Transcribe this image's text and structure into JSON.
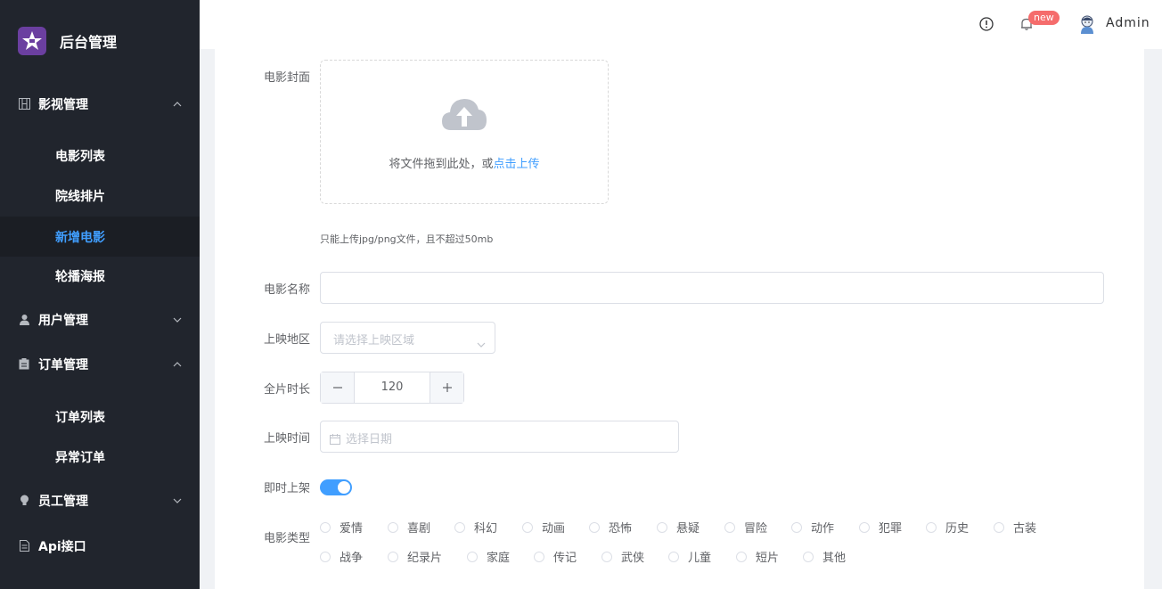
{
  "sidebar": {
    "brand_title": "后台管理",
    "menu": [
      {
        "label": "影视管理"
      },
      {
        "label": "电影列表"
      },
      {
        "label": "院线排片"
      },
      {
        "label": "新增电影"
      },
      {
        "label": "轮播海报"
      },
      {
        "label": "用户管理"
      },
      {
        "label": "订单管理"
      },
      {
        "label": "订单列表"
      },
      {
        "label": "异常订单"
      },
      {
        "label": "员工管理"
      },
      {
        "label": "Api接口"
      }
    ]
  },
  "header": {
    "badge": "new",
    "username": "Admin"
  },
  "form": {
    "cover_label": "电影封面",
    "upload_text": "将文件拖到此处，或",
    "upload_link": "点击上传",
    "upload_tip": "只能上传jpg/png文件，且不超过50mb",
    "name_label": "电影名称",
    "name_value": "",
    "region_label": "上映地区",
    "region_placeholder": "请选择上映区域",
    "duration_label": "全片时长",
    "duration_value": "120",
    "release_label": "上映时间",
    "release_placeholder": "选择日期",
    "publish_label": "即时上架",
    "publish_on": true,
    "genre_label": "电影类型",
    "genres": [
      "爱情",
      "喜剧",
      "科幻",
      "动画",
      "恐怖",
      "悬疑",
      "冒险",
      "动作",
      "犯罪",
      "历史",
      "古装",
      "战争",
      "纪录片",
      "家庭",
      "传记",
      "武侠",
      "儿童",
      "短片",
      "其他"
    ]
  },
  "colors": {
    "sidebar_bg": "#21252d",
    "accent": "#409eff",
    "badge": "#f56c6c"
  }
}
